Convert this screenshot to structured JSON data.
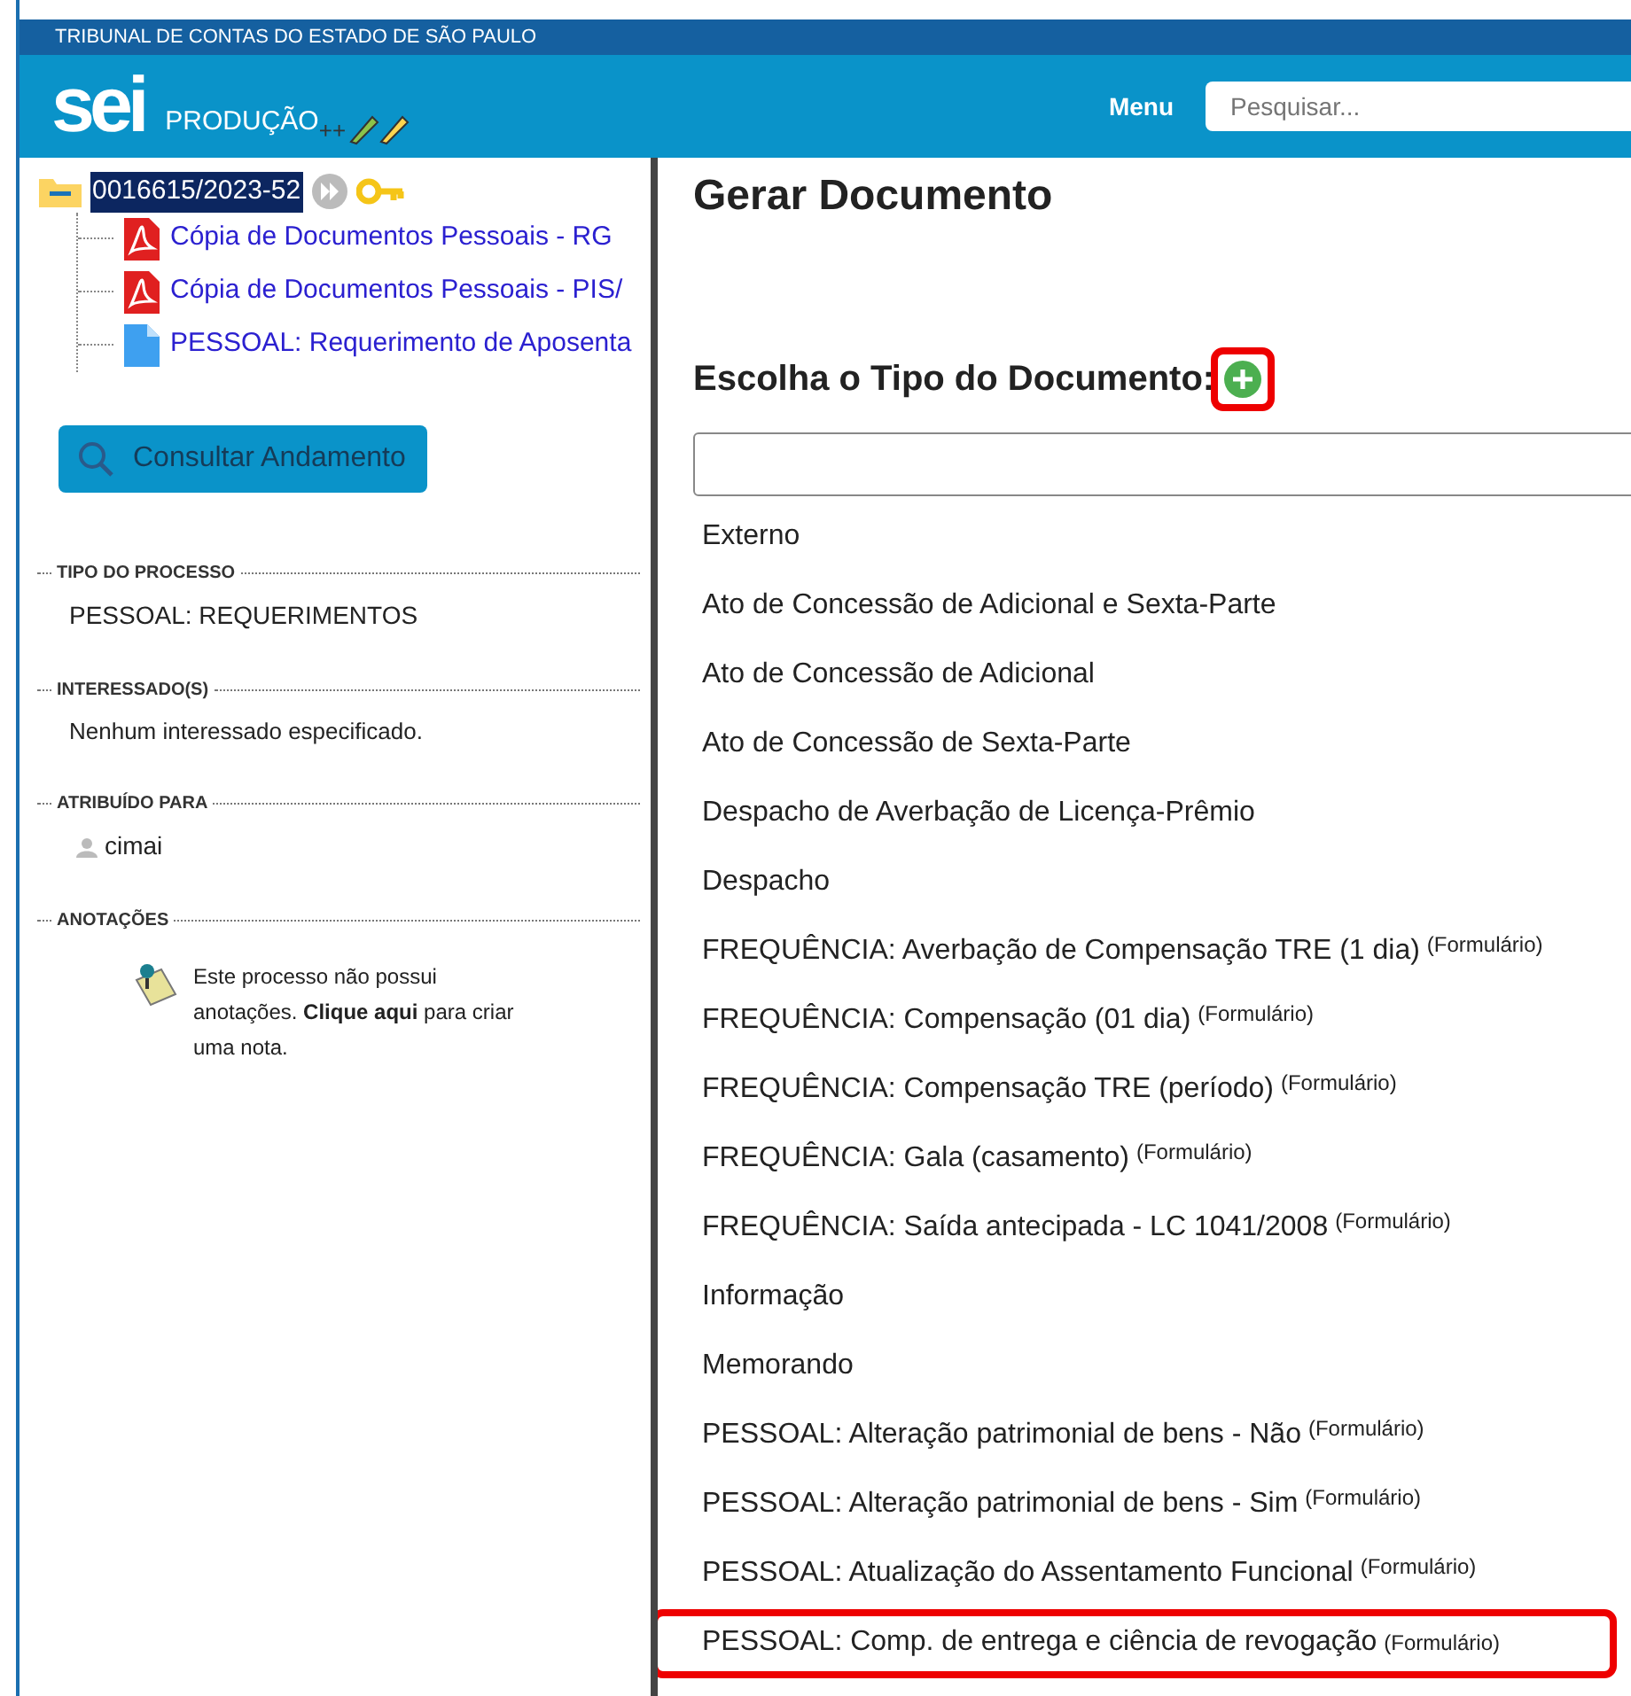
{
  "top_bar": {
    "title": "TRIBUNAL DE CONTAS DO ESTADO DE SÃO PAULO"
  },
  "header": {
    "logo": "sei",
    "environment": "PRODUÇÃO",
    "suffix": "++",
    "menu": "Menu",
    "search": {
      "placeholder": "Pesquisar..."
    }
  },
  "process_tree": {
    "number": "0016615/2023-52",
    "selected": true,
    "children": [
      {
        "kind": "pdf",
        "label": "Cópia de Documentos Pessoais - RG"
      },
      {
        "kind": "pdf",
        "label": "Cópia de Documentos Pessoais - PIS/"
      },
      {
        "kind": "doc",
        "label": "PESSOAL: Requerimento de Aposenta"
      }
    ]
  },
  "consult_button": "Consultar Andamento",
  "sections": [
    {
      "kind": "text",
      "title": "TIPO DO PROCESSO",
      "value": "PESSOAL: REQUERIMENTOS"
    },
    {
      "kind": "text",
      "title": "INTERESSADO(S)",
      "value": "Nenhum interessado especificado."
    },
    {
      "kind": "user",
      "title": "ATRIBUÍDO PARA",
      "value": "cimai"
    },
    {
      "kind": "note",
      "title": "ANOTAÇÕES",
      "value": "Este processo não possui anotações. **Clique aqui** para criar uma nota."
    }
  ],
  "main": {
    "title": "Gerar Documento",
    "subtitle": "Escolha o Tipo do Documento:",
    "add_highlighted": true,
    "document_types": [
      {
        "label": "Externo",
        "highlighted": false
      },
      {
        "label": "Ato de Concessão de Adicional e Sexta-Parte",
        "highlighted": false
      },
      {
        "label": "Ato de Concessão de Adicional",
        "highlighted": false
      },
      {
        "label": "Ato de Concessão de Sexta-Parte",
        "highlighted": false
      },
      {
        "label": "Despacho de Averbação de Licença-Prêmio",
        "highlighted": false
      },
      {
        "label": "Despacho",
        "highlighted": false
      },
      {
        "label": "FREQUÊNCIA: Averbação de Compensação TRE (1 dia)",
        "tag": "(Formulário)",
        "highlighted": false
      },
      {
        "label": "FREQUÊNCIA: Compensação (01 dia)",
        "tag": "(Formulário)",
        "highlighted": false
      },
      {
        "label": "FREQUÊNCIA: Compensação TRE (período)",
        "tag": "(Formulário)",
        "highlighted": false
      },
      {
        "label": "FREQUÊNCIA: Gala (casamento)",
        "tag": "(Formulário)",
        "highlighted": false
      },
      {
        "label": "FREQUÊNCIA: Saída antecipada - LC 1041/2008",
        "tag": "(Formulário)",
        "highlighted": false
      },
      {
        "label": "Informação",
        "highlighted": false
      },
      {
        "label": "Memorando",
        "highlighted": false
      },
      {
        "label": "PESSOAL: Alteração patrimonial de bens - Não",
        "tag": "(Formulário)",
        "highlighted": false
      },
      {
        "label": "PESSOAL: Alteração patrimonial de bens - Sim",
        "tag": "(Formulário)",
        "highlighted": false
      },
      {
        "label": "PESSOAL: Atualização do Assentamento Funcional",
        "tag": "(Formulário)",
        "highlighted": false
      },
      {
        "label": "PESSOAL: Comp. de entrega e ciência de revogação",
        "tag": "(Formulário)",
        "highlighted": true
      }
    ]
  }
}
